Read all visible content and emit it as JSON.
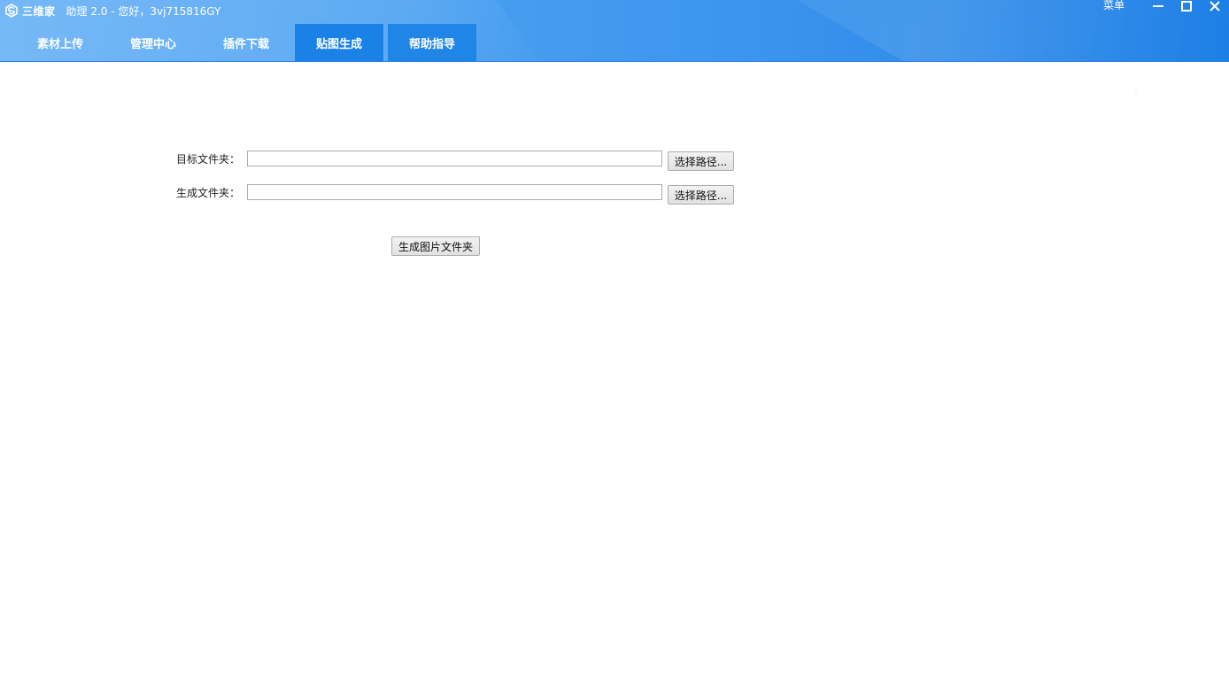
{
  "app": {
    "name": "三维家",
    "title": "助理 2.0 - 您好，3vj715816GY",
    "menu_label": "菜单"
  },
  "icons": {
    "logo": "sanweijia-logo-icon",
    "minimize": "minimize-icon",
    "maximize": "maximize-icon",
    "close": "close-icon"
  },
  "colors": {
    "header_start": "#58a9f5",
    "header_end": "#1c7ee6",
    "tab_active": "#1a82e6"
  },
  "tabs": [
    {
      "label": "素材上传",
      "active": false
    },
    {
      "label": "管理中心",
      "active": false
    },
    {
      "label": "插件下载",
      "active": false
    },
    {
      "label": "贴图生成",
      "active": true
    },
    {
      "label": "帮助指导",
      "active": false
    }
  ],
  "form": {
    "target_folder": {
      "label": "目标文件夹：",
      "value": "",
      "button": "选择路径..."
    },
    "output_folder": {
      "label": "生成文件夹：",
      "value": "",
      "button": "选择路径..."
    },
    "generate_button": "生成图片文件夹"
  }
}
